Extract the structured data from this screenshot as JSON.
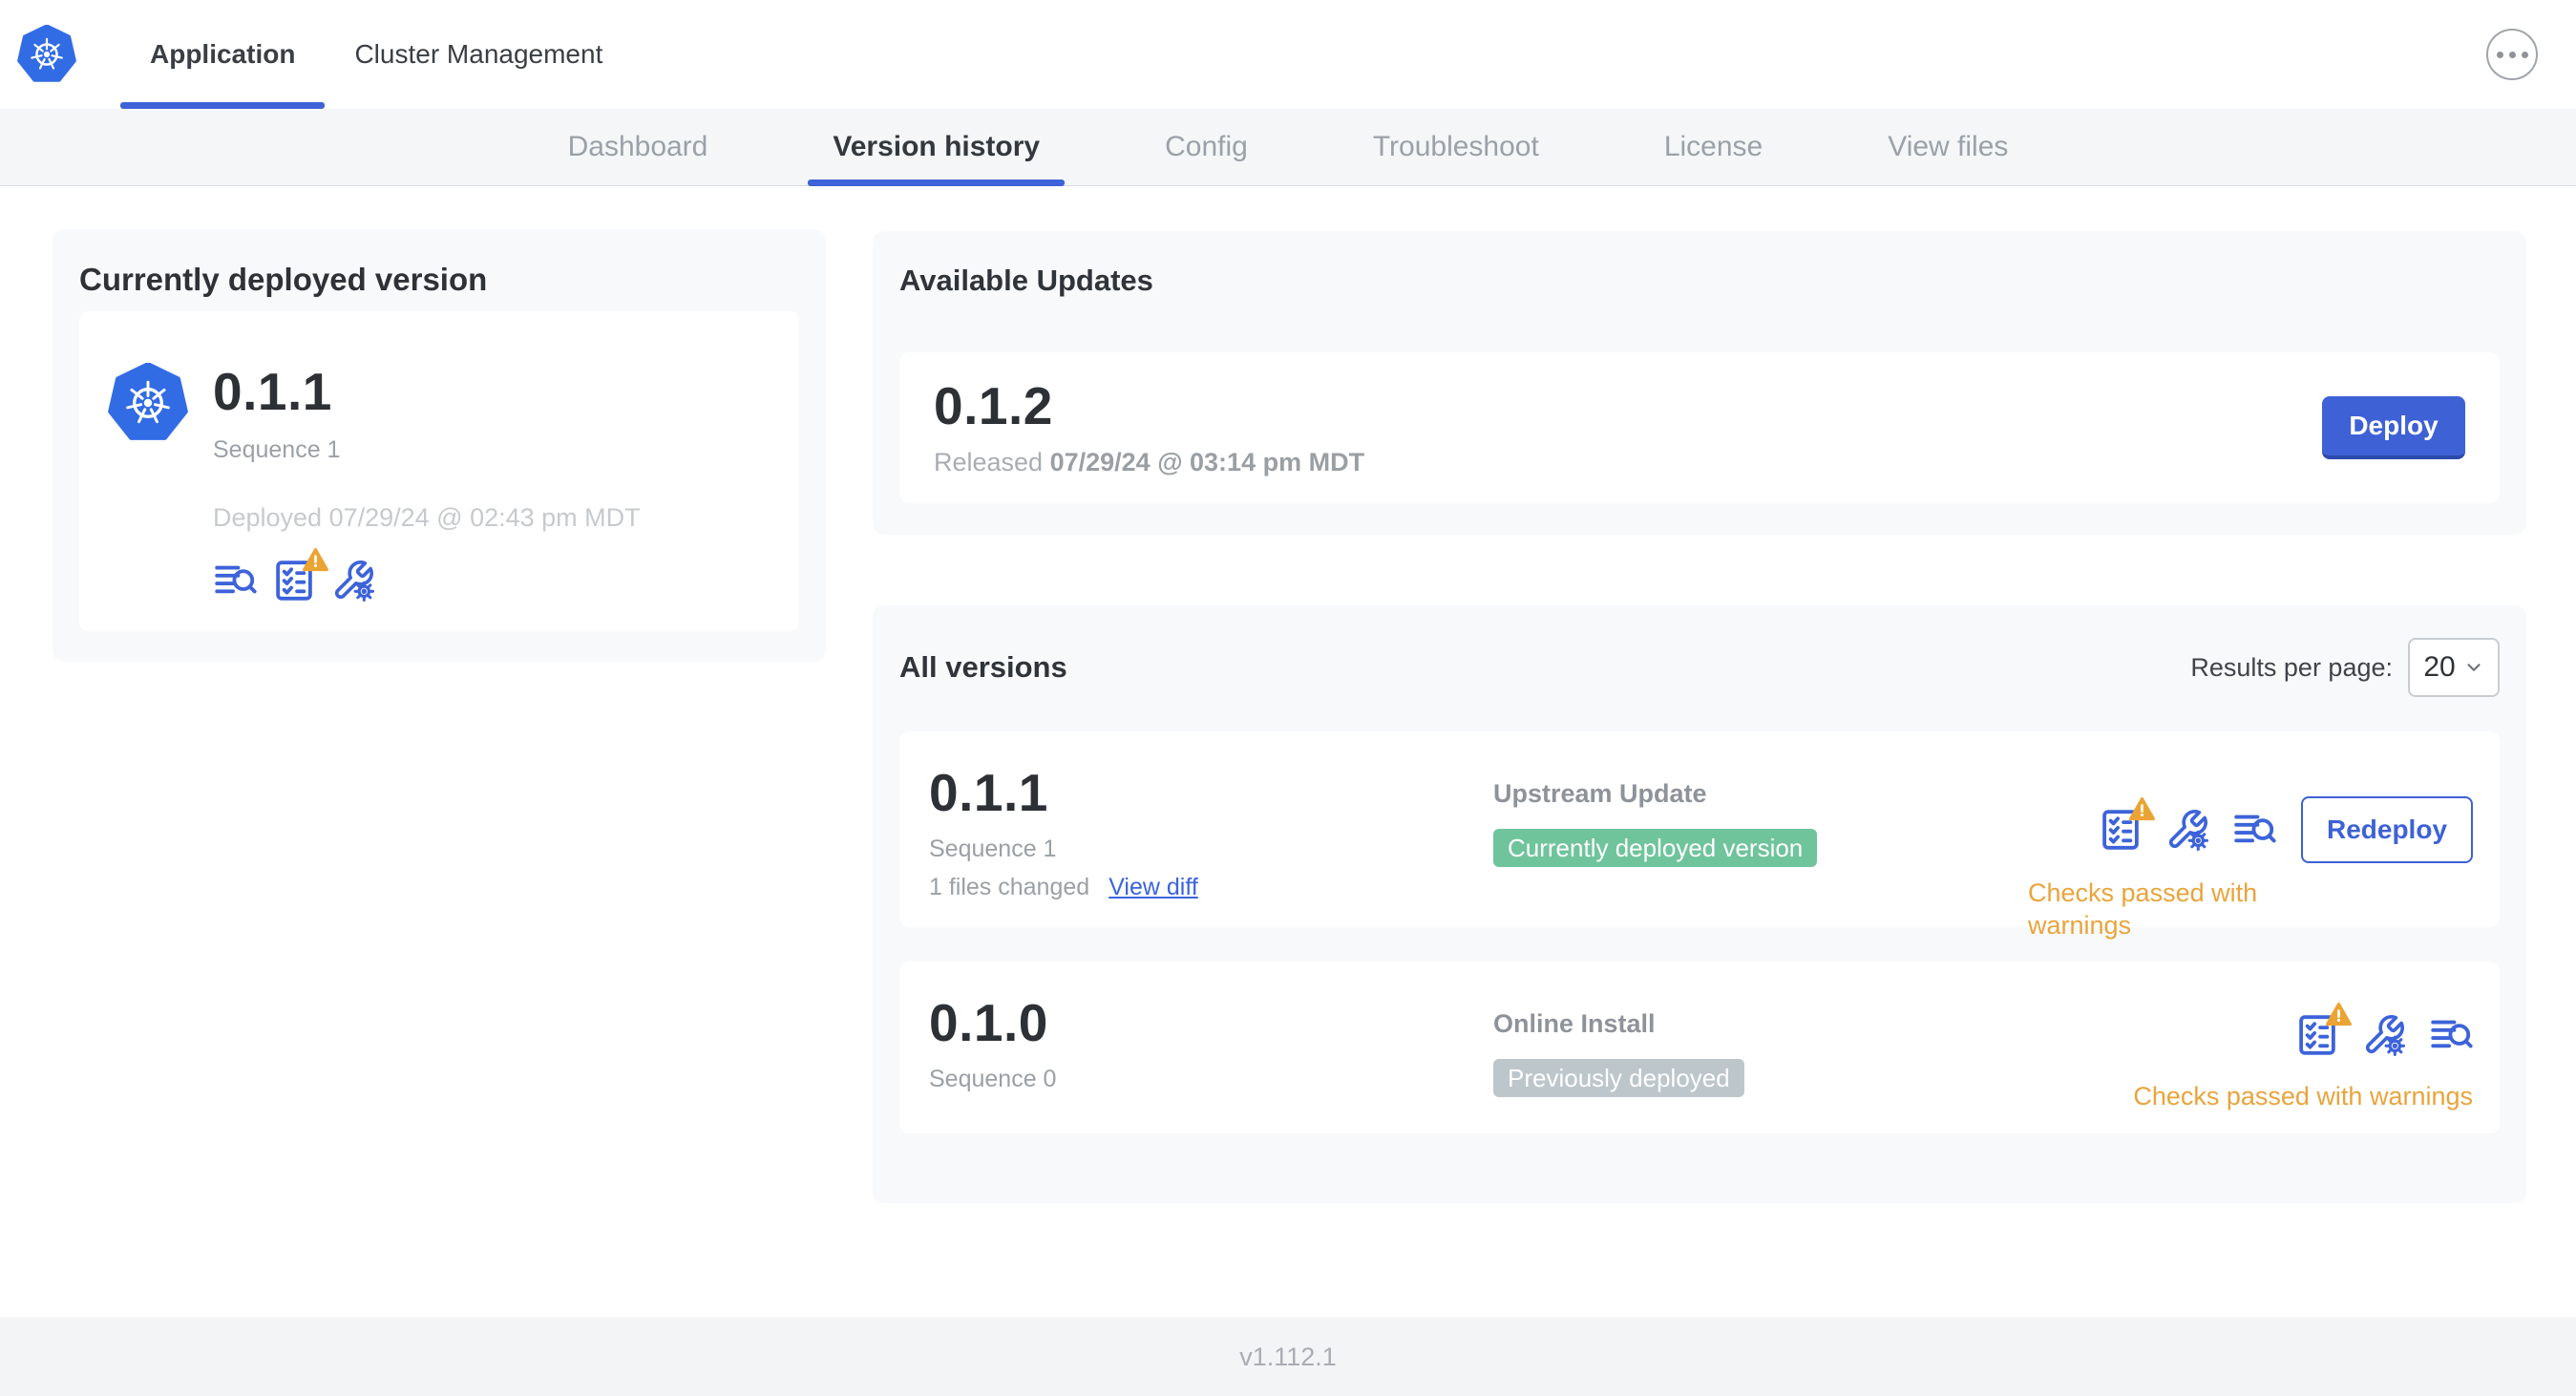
{
  "topbar": {
    "tabs": [
      {
        "label": "Application",
        "active": true
      },
      {
        "label": "Cluster Management",
        "active": false
      }
    ]
  },
  "subnav": {
    "tabs": [
      {
        "label": "Dashboard",
        "active": false
      },
      {
        "label": "Version history",
        "active": true
      },
      {
        "label": "Config",
        "active": false
      },
      {
        "label": "Troubleshoot",
        "active": false
      },
      {
        "label": "License",
        "active": false
      },
      {
        "label": "View files",
        "active": false
      }
    ]
  },
  "current_version": {
    "title": "Currently deployed version",
    "version": "0.1.1",
    "sequence": "Sequence 1",
    "deployed": "Deployed 07/29/24 @ 02:43 pm MDT"
  },
  "available_updates": {
    "title": "Available Updates",
    "version": "0.1.2",
    "released_prefix": "Released ",
    "released_date": "07/29/24 @ 03:14 pm MDT",
    "deploy_label": "Deploy"
  },
  "all_versions": {
    "title": "All versions",
    "results_per_page_label": "Results per page:",
    "results_per_page_value": "20",
    "rows": [
      {
        "version": "0.1.1",
        "sequence": "Sequence 1",
        "files_changed": "1 files changed",
        "view_diff_label": "View diff",
        "source": "Upstream Update",
        "badge": "Currently deployed version",
        "checks_status": "Checks passed with warnings",
        "action_label": "Redeploy"
      },
      {
        "version": "0.1.0",
        "sequence": "Sequence 0",
        "source": "Online Install",
        "badge": "Previously deployed",
        "checks_status": "Checks passed with warnings"
      }
    ]
  },
  "footer": {
    "app_version": "v1.112.1"
  },
  "icons": {
    "brand": "kubernetes-logo",
    "top_right": "ellipsis-menu-icon",
    "logs": "logs-magnifier-icon",
    "preflight": "preflight-checklist-icon",
    "preflight_warning": "warning-triangle-icon",
    "config": "wrench-gear-icon",
    "select": "chevron-down-icon"
  },
  "colors": {
    "accent_blue": "#3e63d8",
    "kubernetes_blue": "#326ce5",
    "deploy_button_blue": "#3e61d6",
    "currently_deployed_badge": "#6fc49b",
    "previously_deployed_badge": "#bdc6cb",
    "warning_amber": "#e9a43c",
    "subnav_background": "#f4f6f8",
    "card_background": "#f8f9fa"
  }
}
